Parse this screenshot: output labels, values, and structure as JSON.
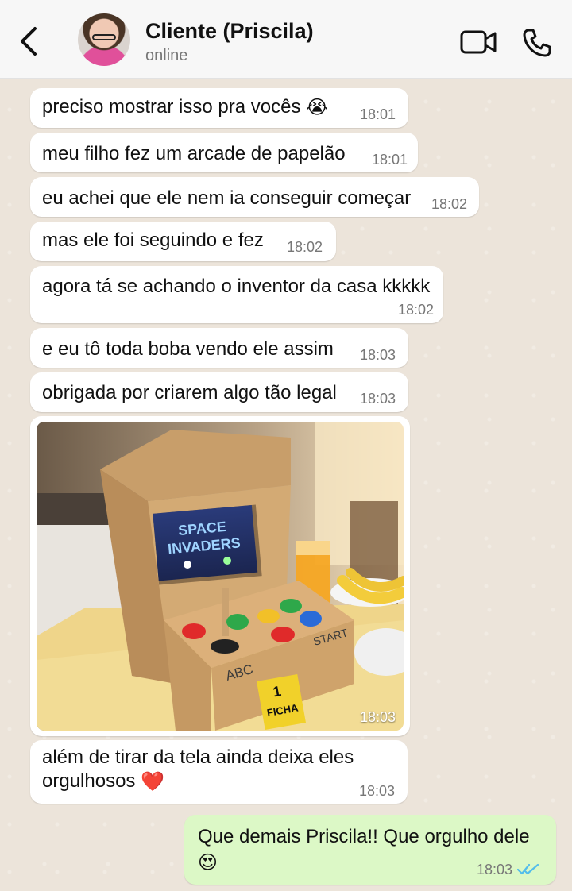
{
  "header": {
    "contact_name": "Cliente (Priscila)",
    "status": "online",
    "icons": [
      "back-arrow-icon",
      "avatar",
      "video-call-icon",
      "phone-call-icon"
    ]
  },
  "messages": [
    {
      "text": "preciso mostrar isso pra vocês",
      "emoji": "😭",
      "time": "18:01"
    },
    {
      "text": "meu filho fez um arcade de papelão",
      "time": "18:01"
    },
    {
      "text": "eu achei que ele nem ia conseguir começar",
      "time": "18:02"
    },
    {
      "text": "mas ele foi seguindo e fez",
      "time": "18:02"
    },
    {
      "text": "agora tá se achando o inventor da casa kkkkk",
      "time": "18:02"
    },
    {
      "text": "e eu tô toda boba vendo ele assim",
      "time": "18:03"
    },
    {
      "text": "obrigada por criarem algo tão legal",
      "time": "18:03"
    },
    {
      "image_time": "18:03",
      "image_text": {
        "title1": "SPACE",
        "title2": "INVADERS",
        "letters": "ABC",
        "start": "START",
        "ticket_num": "1",
        "ticket_word": "FICHA"
      }
    },
    {
      "line1": "além de tirar da tela ainda deixa eles",
      "line2": "orgulhosos",
      "emoji": "❤️",
      "time": "18:03"
    }
  ],
  "outgoing": {
    "line1": "Que demais Priscila!! Que orgulho dele",
    "emoji": "😍",
    "time": "18:03",
    "read_receipt": "double-check-blue"
  },
  "colors": {
    "outgoing_bubble": "#dcf8c6",
    "incoming_bubble": "#ffffff",
    "read_tick": "#53bdeb",
    "background": "#ece4da"
  }
}
